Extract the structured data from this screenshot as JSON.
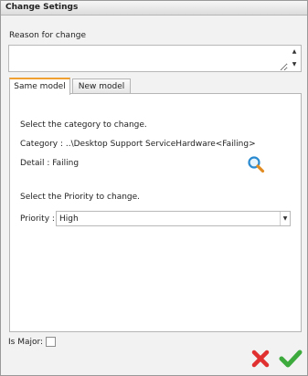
{
  "dialog": {
    "title": "Change Setings"
  },
  "reason": {
    "label": "Reason for change",
    "value": "",
    "spin_up": "▲",
    "spin_down": "▼"
  },
  "tabs": [
    {
      "label": "Same model",
      "active": true
    },
    {
      "label": "New model",
      "active": false
    }
  ],
  "panel": {
    "category_prompt": "Select the category to change.",
    "category_line": "Category : ..\\Desktop Support ServiceHardware<Failing>",
    "detail_line": "Detail : Failing",
    "priority_prompt": "Select the Priority to change.",
    "priority_label": "Priority :",
    "priority_value": "High",
    "select_arrow": "▼"
  },
  "footer": {
    "is_major_label": "Is Major:",
    "is_major_checked": false
  },
  "colors": {
    "tab_accent": "#f0a030",
    "search_icon": "#2a8ad0",
    "cancel": "#e03030",
    "ok": "#3caa3c"
  }
}
